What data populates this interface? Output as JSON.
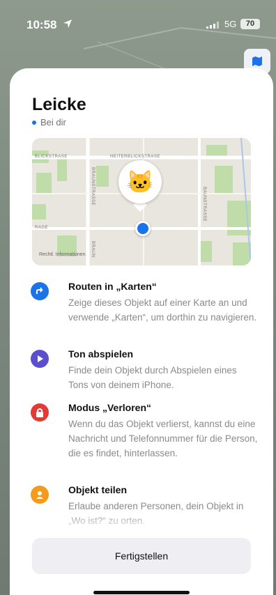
{
  "status_bar": {
    "time": "10:58",
    "network": "5G",
    "battery": "70"
  },
  "item": {
    "name": "Leicke",
    "location": "Bei dir",
    "emoji": "🐱"
  },
  "map": {
    "labels": {
      "street1": "BLICKSTRASE",
      "street2": "HEITERBLICKSTRASE",
      "street3": "BRAUNSTRASSE",
      "street4": "BRAUN",
      "street5": "BAUNSTRASSE",
      "street6": "RAGE"
    },
    "legal": "Rechtl. Informationen"
  },
  "actions": [
    {
      "title": "Routen in „Karten“",
      "description": "Zeige dieses Objekt auf einer Karte an und verwende „Karten“, um dorthin zu navigieren.",
      "icon": "route-arrow-icon",
      "color": "#1a73e8"
    },
    {
      "title": "Ton abspielen",
      "description": "Finde dein Objekt durch Abspielen eines Tons von deinem iPhone.",
      "icon": "play-icon",
      "color": "#5b4fcf"
    },
    {
      "title": "Modus „Verloren“",
      "description": "Wenn du das Objekt verlierst, kannst du eine Nachricht und Telefonnummer für die Person, die es findet, hinterlassen.",
      "icon": "lock-icon",
      "color": "#e53935"
    },
    {
      "title": "Objekt teilen",
      "description": "Erlaube anderen Personen, dein Objekt in „Wo ist?“ zu orten.",
      "icon": "share-person-icon",
      "color": "#f29b1d"
    }
  ],
  "footer": {
    "done_label": "Fertigstellen"
  }
}
